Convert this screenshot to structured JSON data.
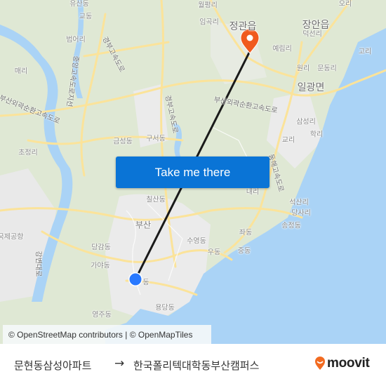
{
  "map": {
    "places": [
      {
        "name": "유산동",
        "cls": ""
      },
      {
        "name": "교동",
        "cls": ""
      },
      {
        "name": "범어리",
        "cls": ""
      },
      {
        "name": "매리",
        "cls": ""
      },
      {
        "name": "초정리",
        "cls": ""
      },
      {
        "name": "금성동",
        "cls": ""
      },
      {
        "name": "구서동",
        "cls": ""
      },
      {
        "name": "월평리",
        "cls": ""
      },
      {
        "name": "임곡리",
        "cls": ""
      },
      {
        "name": "정관읍",
        "cls": "big"
      },
      {
        "name": "장안읍",
        "cls": "big"
      },
      {
        "name": "오리",
        "cls": ""
      },
      {
        "name": "덕선리",
        "cls": ""
      },
      {
        "name": "예림리",
        "cls": ""
      },
      {
        "name": "고리",
        "cls": ""
      },
      {
        "name": "원리",
        "cls": ""
      },
      {
        "name": "문동리",
        "cls": ""
      },
      {
        "name": "일광면",
        "cls": "big"
      },
      {
        "name": "삼성리",
        "cls": ""
      },
      {
        "name": "학리",
        "cls": ""
      },
      {
        "name": "교리",
        "cls": ""
      },
      {
        "name": "내리",
        "cls": ""
      },
      {
        "name": "석산리",
        "cls": ""
      },
      {
        "name": "당사리",
        "cls": ""
      },
      {
        "name": "송정동",
        "cls": ""
      },
      {
        "name": "좌동",
        "cls": ""
      },
      {
        "name": "중동",
        "cls": ""
      },
      {
        "name": "우동",
        "cls": ""
      },
      {
        "name": "수영동",
        "cls": ""
      },
      {
        "name": "칠산동",
        "cls": ""
      },
      {
        "name": "부산",
        "cls": "mid"
      },
      {
        "name": "국제공항",
        "cls": ""
      },
      {
        "name": "당감동",
        "cls": ""
      },
      {
        "name": "가야동",
        "cls": ""
      },
      {
        "name": "동",
        "cls": ""
      },
      {
        "name": "용당동",
        "cls": ""
      },
      {
        "name": "영주동",
        "cls": ""
      }
    ],
    "roads": [
      {
        "name": "경부고속도로"
      },
      {
        "name": "중앙고속도로지선"
      },
      {
        "name": "부산외곽순환고속도로"
      },
      {
        "name": "경부고속도로"
      },
      {
        "name": "부산외곽순환고속도로"
      },
      {
        "name": "동해고속도로"
      },
      {
        "name": "강변대로"
      }
    ],
    "origin_marker": {
      "label": "origin",
      "color": "#2979ff"
    },
    "destination_marker": {
      "label": "destination",
      "color": "#f05a1e"
    },
    "route_color": "#1a1a1a"
  },
  "cta": {
    "label": "Take me there",
    "color": "#0a74d6"
  },
  "attribution": {
    "text": "© OpenStreetMap contributors | © OpenMapTiles"
  },
  "footer": {
    "from": "문현동삼성아파트",
    "arrow": "→",
    "to": "한국폴리텍대학동부산캠퍼스",
    "brand": "moovit",
    "brand_color": "#f26b21"
  }
}
